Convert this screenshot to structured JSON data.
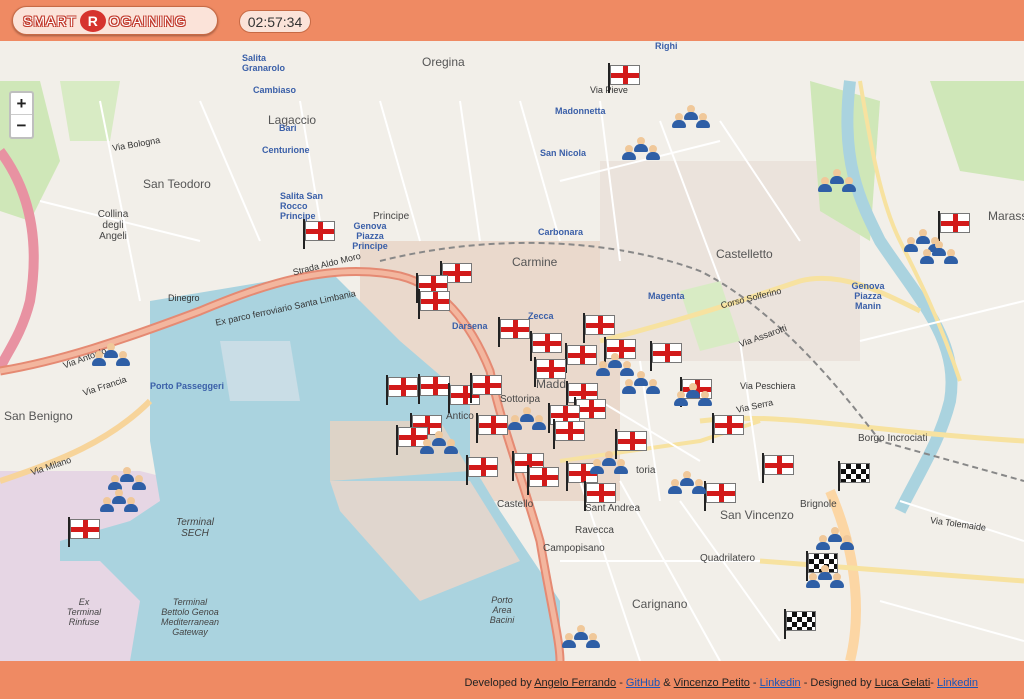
{
  "header": {
    "logo_left": "SMART",
    "logo_mark": "R",
    "logo_right": "OGAINING",
    "timer": "02:57:34"
  },
  "zoom": {
    "in": "+",
    "out": "−"
  },
  "map_labels": {
    "oregina": "Oregina",
    "righi": "Righi",
    "lagaccio": "Lagaccio",
    "san_teodoro": "San Teodoro",
    "collina": "Collina degli Angeli",
    "castelletto": "Castelletto",
    "carmine": "Carmine",
    "maddalena": "Madd",
    "castello": "Castello",
    "sotto_ripa": "Sottoripa",
    "san_vincenzo": "San Vincenzo",
    "carignano": "Carignano",
    "quadrilatero": "Quadrilatero",
    "ravecca": "Ravecca",
    "campopisano": "Campopisano",
    "sant_andrea": "Sant Andrea",
    "san_benigno": "San Benigno",
    "terminal_sech": "Terminal SECH",
    "terminal_bettolo": "Terminal Bettolo Genoa Mediterranean Gateway",
    "ex_terminal": "Ex Terminal Rinfuse",
    "marassi": "Marass",
    "brignole": "Brignole",
    "borgo_incrociati": "Borgo Incrociati",
    "porto_area": "Porto Area Bacini",
    "zecca": "Zecca",
    "magenta": "Magenta",
    "darsena": "Darsena",
    "antico": "Antico",
    "toria": "toria",
    "principe_station": "Genova Piazza Principe",
    "piazza_manin": "Genova Piazza Manin",
    "principe": "Principe",
    "carbonara": "Carbonara",
    "san_nicola": "San Nicola",
    "madonnetta": "Madonnetta",
    "centurione": "Centurione",
    "bari": "Bari",
    "cambiaso": "Cambiaso",
    "salita_granarolo": "Salita Granarolo",
    "salita_san_rocco": "Salita San Rocco Principe",
    "via_pieve": "Via Pieve",
    "via_bologna": "Via Bologna",
    "via_milano": "Via Milano",
    "via_antonio": "Via Antonio",
    "via_francia": "Via Francia",
    "via_serra": "Via Serra",
    "via_tolemaide": "Via Tolemaide",
    "strada_aldo_moro": "Strada Aldo Moro",
    "via_assarotti": "Via Assarotti",
    "corso_solferino": "Corso Solferino",
    "dinegro": "Dinegro",
    "porto_passeggeri": "Porto Passeggeri",
    "ex_parco": "Ex parco ferroviario Santa Limbania",
    "via_pescheria": "Via Peschiera",
    "marassi_label": "Marassi"
  },
  "footer": {
    "developed_by": "Developed by",
    "dev1": "Angelo Ferrando",
    "sep1": " - ",
    "github": "GitHub",
    "amp": " & ",
    "dev2": "Vincenzo Petito",
    "sep2": " - ",
    "linkedin1": "Linkedin",
    "designed_by": " - Designed by ",
    "designer": "Luca Gelati",
    "sep3": "- ",
    "linkedin2": "Linkedin"
  },
  "colors": {
    "accent": "#ef8a63",
    "sea": "#aad3df",
    "flag_red": "#d21a1a",
    "highway": "#e892a2",
    "primary_road": "#fcd6a4"
  }
}
